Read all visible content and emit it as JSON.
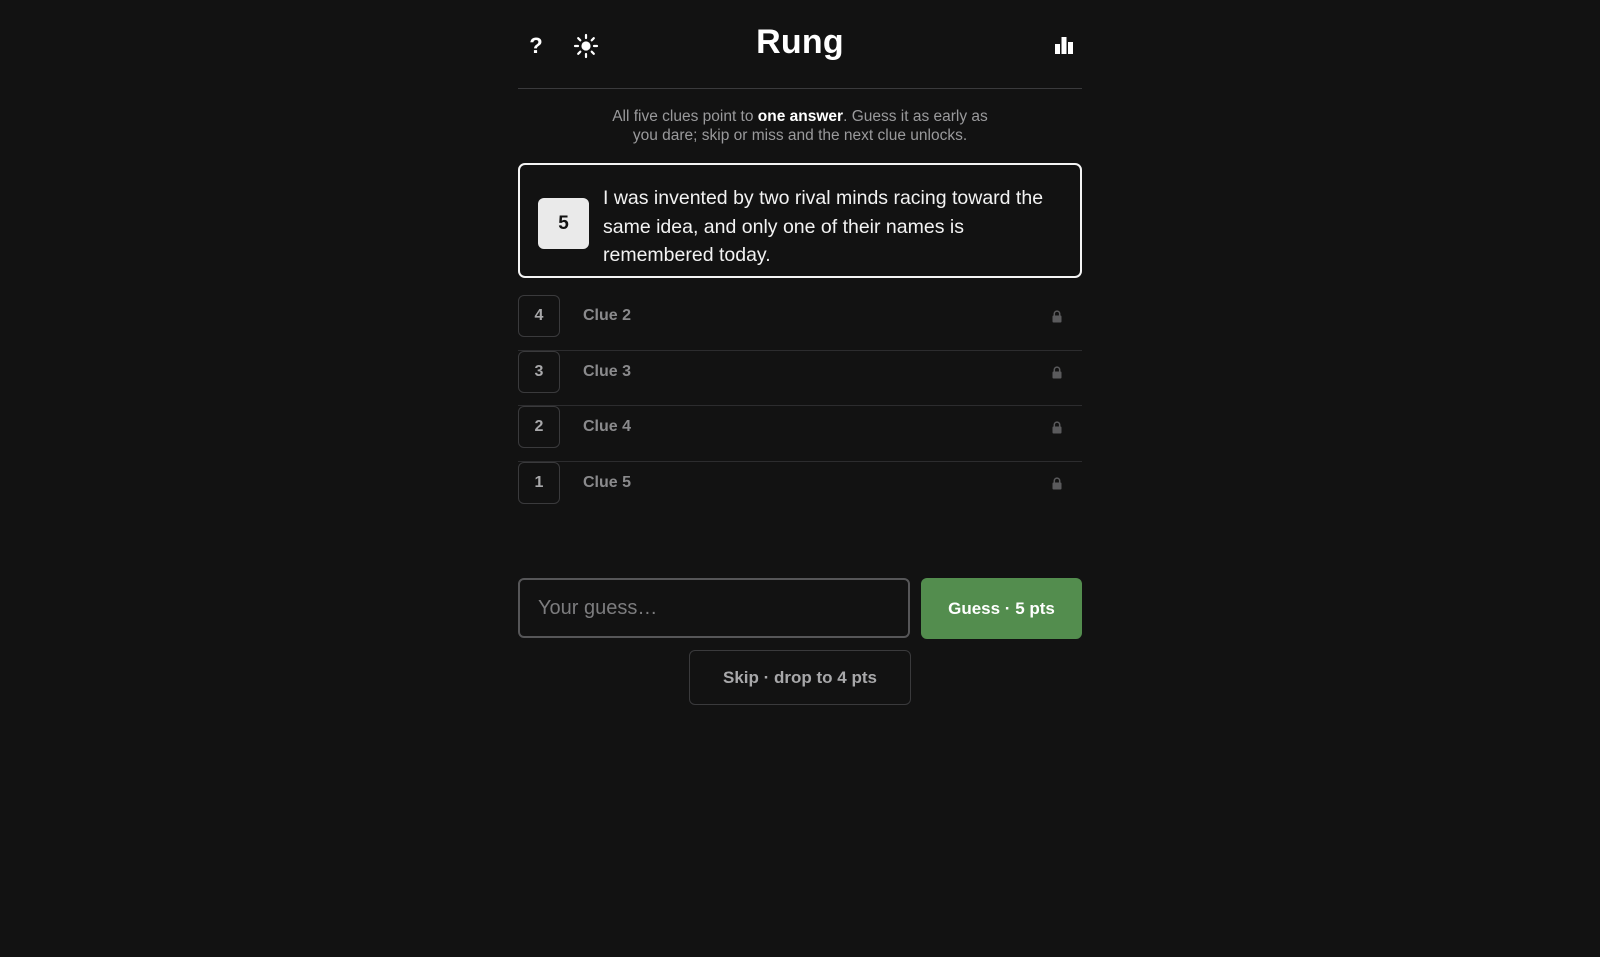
{
  "header": {
    "title": "Rung",
    "help_label": "?",
    "icons": {
      "help": "question-icon",
      "theme": "sun-icon",
      "stats": "bar-chart-icon"
    }
  },
  "intro": {
    "prefix": "All five clues point to ",
    "emphasis": "one answer",
    "suffix": ". Guess it as early as you dare; skip or miss and the next clue unlocks."
  },
  "active_clue": {
    "points": "5",
    "text": "I was invented by two rival minds racing toward the same idea, and only one of their names is remembered today."
  },
  "locked_clues": [
    {
      "points": "4",
      "label": "Clue 2"
    },
    {
      "points": "3",
      "label": "Clue 3"
    },
    {
      "points": "2",
      "label": "Clue 4"
    },
    {
      "points": "1",
      "label": "Clue 5"
    }
  ],
  "guess": {
    "placeholder": "Your guess…",
    "value": "",
    "button_label": "Guess · 5 pts"
  },
  "skip": {
    "label": "Skip · drop to 4 pts"
  },
  "colors": {
    "background": "#121212",
    "accent_green": "#538d4e",
    "border": "#3a3a3c"
  }
}
